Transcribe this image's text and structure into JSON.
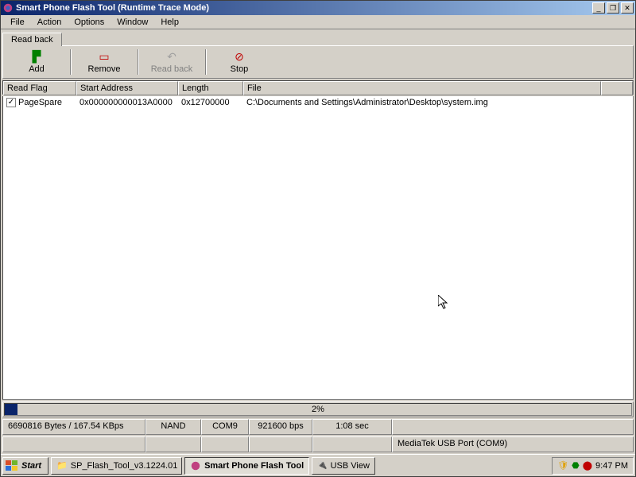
{
  "window": {
    "title": "Smart Phone Flash Tool (Runtime Trace Mode)"
  },
  "menu": {
    "file": "File",
    "action": "Action",
    "options": "Options",
    "window": "Window",
    "help": "Help"
  },
  "tab": {
    "readback": "Read back"
  },
  "toolbar": {
    "add": "Add",
    "remove": "Remove",
    "readback": "Read back",
    "stop": "Stop"
  },
  "cols": {
    "readflag": "Read Flag",
    "start": "Start Address",
    "length": "Length",
    "file": "File"
  },
  "row": {
    "flag": "PageSpare",
    "start": "0x000000000013A0000",
    "length": "0x12700000",
    "file": "C:\\Documents and Settings\\Administrator\\Desktop\\system.img"
  },
  "progress": {
    "pct": "2%",
    "width": "2%"
  },
  "status": {
    "bytes": "6690816 Bytes / 167.54 KBps",
    "nand": "NAND",
    "com": "COM9",
    "baud": "921600 bps",
    "time": "1:08 sec",
    "port": "MediaTek USB Port (COM9)"
  },
  "taskbar": {
    "start": "Start",
    "t1": "SP_Flash_Tool_v3.1224.01",
    "t2": "Smart Phone Flash Tool",
    "t3": "USB View",
    "clock": "9:47 PM"
  }
}
